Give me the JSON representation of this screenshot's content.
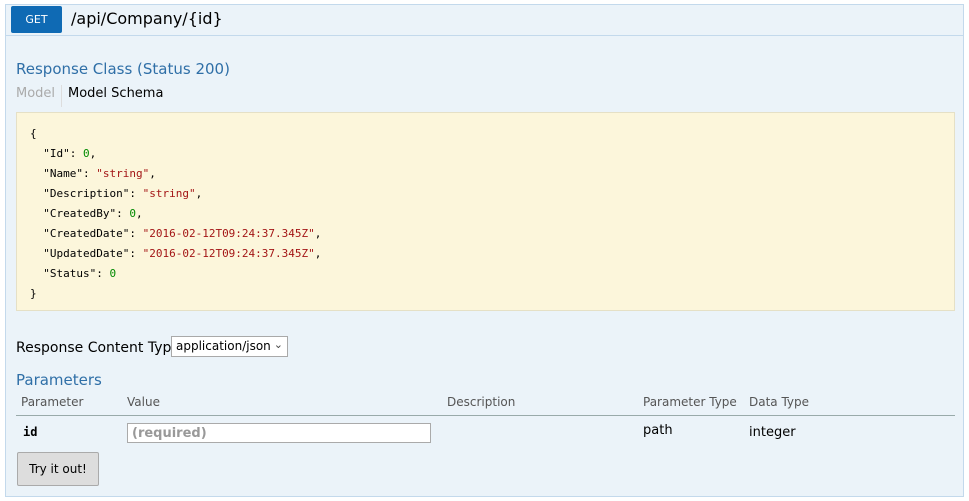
{
  "operation": {
    "method": "GET",
    "path": "/api/Company/{id}"
  },
  "response_class": {
    "title": "Response Class (Status 200)",
    "tabs": {
      "model": "Model",
      "schema": "Model Schema"
    },
    "schema_lines": {
      "open": "{",
      "id_key": "\"Id\": ",
      "id_val": "0",
      "name_key": "\"Name\": ",
      "name_val": "\"string\"",
      "desc_key": "\"Description\": ",
      "desc_val": "\"string\"",
      "createdby_key": "\"CreatedBy\": ",
      "createdby_val": "0",
      "createddate_key": "\"CreatedDate\": ",
      "createddate_val": "\"2016-02-12T09:24:37.345Z\"",
      "updateddate_key": "\"UpdatedDate\": ",
      "updateddate_val": "\"2016-02-12T09:24:37.345Z\"",
      "status_key": "\"Status\": ",
      "status_val": "0",
      "close": "}"
    }
  },
  "content_type": {
    "label": "Response Content Type",
    "selected": "application/json"
  },
  "parameters": {
    "title": "Parameters",
    "headers": [
      "Parameter",
      "Value",
      "Description",
      "Parameter Type",
      "Data Type"
    ],
    "rows": [
      {
        "name": "id",
        "value": "",
        "placeholder": "(required)",
        "description": "",
        "param_type": "path",
        "data_type": "integer"
      }
    ]
  },
  "actions": {
    "try_label": "Try it out!"
  },
  "colors": {
    "method_bg": "#0f6ab4",
    "section_title": "#2f6fa7",
    "panel_bg": "#ebf3f9",
    "schema_bg": "#fcf6db"
  }
}
